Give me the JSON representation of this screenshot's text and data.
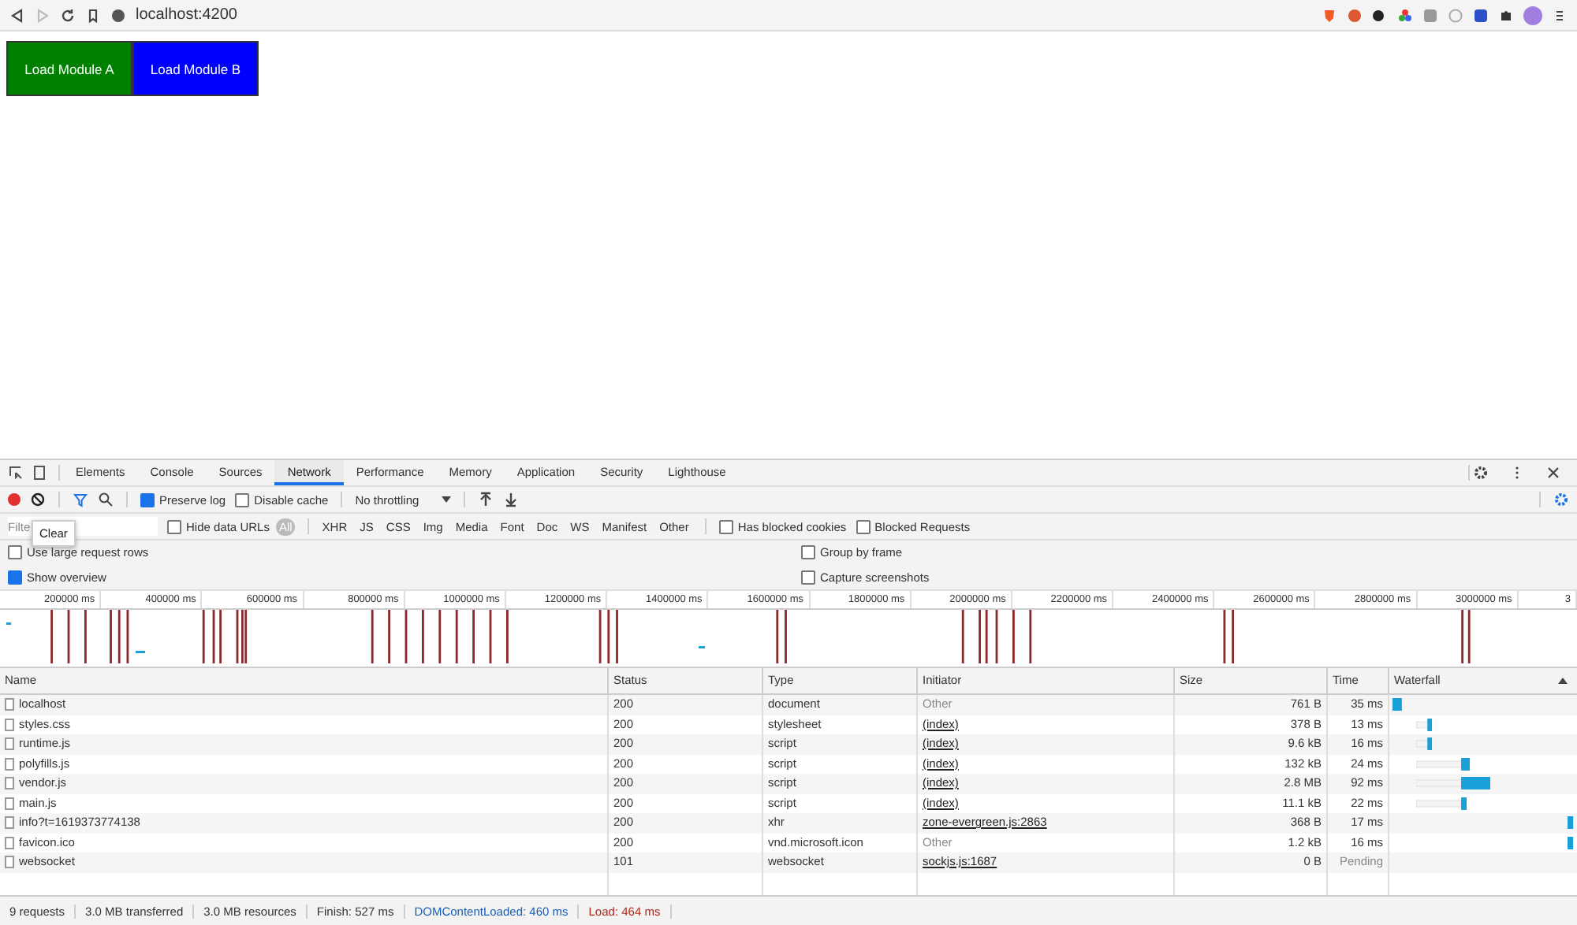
{
  "browser": {
    "url": "localhost:4200",
    "back_disabled": false,
    "forward_disabled": true
  },
  "page": {
    "buttons": [
      {
        "label": "Load Module A",
        "color": "#008000"
      },
      {
        "label": "Load Module B",
        "color": "#0000ff"
      }
    ]
  },
  "devtools": {
    "tabs": [
      {
        "label": "Elements",
        "selected": false
      },
      {
        "label": "Console",
        "selected": false
      },
      {
        "label": "Sources",
        "selected": false
      },
      {
        "label": "Network",
        "selected": true
      },
      {
        "label": "Performance",
        "selected": false
      },
      {
        "label": "Memory",
        "selected": false
      },
      {
        "label": "Application",
        "selected": false
      },
      {
        "label": "Security",
        "selected": false
      },
      {
        "label": "Lighthouse",
        "selected": false
      }
    ],
    "toolbar": {
      "recording": true,
      "preserve_log": {
        "label": "Preserve log",
        "checked": true
      },
      "disable_cache": {
        "label": "Disable cache",
        "checked": false
      },
      "throttling": "No throttling"
    },
    "filter": {
      "placeholder": "Filte",
      "tooltip": "Clear",
      "hide_data_urls": {
        "label": "Hide data URLs",
        "checked": false
      },
      "types": [
        {
          "label": "All",
          "selected": true
        },
        {
          "label": "XHR",
          "selected": false
        },
        {
          "label": "JS",
          "selected": false
        },
        {
          "label": "CSS",
          "selected": false
        },
        {
          "label": "Img",
          "selected": false
        },
        {
          "label": "Media",
          "selected": false
        },
        {
          "label": "Font",
          "selected": false
        },
        {
          "label": "Doc",
          "selected": false
        },
        {
          "label": "WS",
          "selected": false
        },
        {
          "label": "Manifest",
          "selected": false
        },
        {
          "label": "Other",
          "selected": false
        }
      ],
      "has_blocked_cookies": {
        "label": "Has blocked cookies",
        "checked": false
      },
      "blocked_requests": {
        "label": "Blocked Requests",
        "checked": false
      }
    },
    "options": [
      {
        "label": "Use large request rows",
        "checked": false
      },
      {
        "label": "Group by frame",
        "checked": false
      },
      {
        "label": "Show overview",
        "checked": true
      },
      {
        "label": "Capture screenshots",
        "checked": false
      }
    ],
    "overview_ticks": [
      "200000 ms",
      "400000 ms",
      "600000 ms",
      "800000 ms",
      "1000000 ms",
      "1200000 ms",
      "1400000 ms",
      "1600000 ms",
      "1800000 ms",
      "2000000 ms",
      "2200000 ms",
      "2400000 ms",
      "2600000 ms",
      "2800000 ms",
      "3000000 ms",
      "3"
    ],
    "table": {
      "columns": [
        "Name",
        "Status",
        "Type",
        "Initiator",
        "Size",
        "Time",
        "Waterfall"
      ],
      "rows": [
        {
          "name": "localhost",
          "status": "200",
          "type": "document",
          "initiator": "Other",
          "initiator_link": false,
          "size": "761 B",
          "time": "35 ms",
          "pending": false
        },
        {
          "name": "styles.css",
          "status": "200",
          "type": "stylesheet",
          "initiator": "(index)",
          "initiator_link": true,
          "size": "378 B",
          "time": "13 ms",
          "pending": false
        },
        {
          "name": "runtime.js",
          "status": "200",
          "type": "script",
          "initiator": "(index)",
          "initiator_link": true,
          "size": "9.6 kB",
          "time": "16 ms",
          "pending": false
        },
        {
          "name": "polyfills.js",
          "status": "200",
          "type": "script",
          "initiator": "(index)",
          "initiator_link": true,
          "size": "132 kB",
          "time": "24 ms",
          "pending": false
        },
        {
          "name": "vendor.js",
          "status": "200",
          "type": "script",
          "initiator": "(index)",
          "initiator_link": true,
          "size": "2.8 MB",
          "time": "92 ms",
          "pending": false
        },
        {
          "name": "main.js",
          "status": "200",
          "type": "script",
          "initiator": "(index)",
          "initiator_link": true,
          "size": "11.1 kB",
          "time": "22 ms",
          "pending": false
        },
        {
          "name": "info?t=1619373774138",
          "status": "200",
          "type": "xhr",
          "initiator": "zone-evergreen.js:2863",
          "initiator_link": true,
          "size": "368 B",
          "time": "17 ms",
          "pending": false
        },
        {
          "name": "favicon.ico",
          "status": "200",
          "type": "vnd.microsoft.icon",
          "initiator": "Other",
          "initiator_link": false,
          "size": "1.2 kB",
          "time": "16 ms",
          "pending": false
        },
        {
          "name": "websocket",
          "status": "101",
          "type": "websocket",
          "initiator": "sockjs.js:1687",
          "initiator_link": true,
          "size": "0 B",
          "time": "Pending",
          "pending": true
        }
      ]
    },
    "status_bar": [
      {
        "text": "9 requests",
        "kind": "plain"
      },
      {
        "text": "3.0 MB transferred",
        "kind": "plain"
      },
      {
        "text": "3.0 MB resources",
        "kind": "plain"
      },
      {
        "text": "Finish: 527 ms",
        "kind": "plain"
      },
      {
        "text": "DOMContentLoaded: 460 ms",
        "kind": "dcl"
      },
      {
        "text": "Load: 464 ms",
        "kind": "load"
      }
    ]
  }
}
